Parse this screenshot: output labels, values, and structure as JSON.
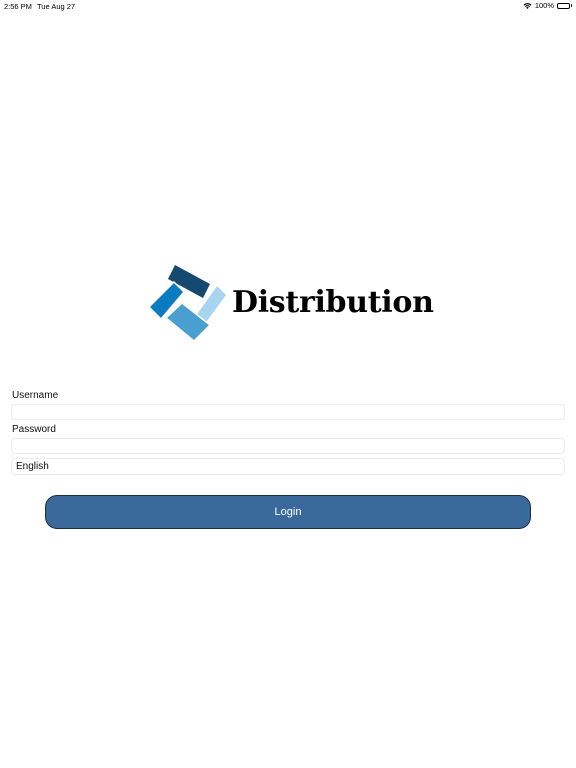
{
  "status_bar": {
    "time": "2:56 PM",
    "date": "Tue Aug 27",
    "battery": "100%",
    "wifi_icon": "wifi-icon",
    "battery_icon": "battery-icon"
  },
  "logo": {
    "text": "Distribution",
    "colors": [
      "#16496f",
      "#0b7bbf",
      "#a9d4f0",
      "#4a9fd0"
    ]
  },
  "form": {
    "username_label": "Username",
    "username_value": "",
    "password_label": "Password",
    "password_value": "",
    "language": "English"
  },
  "login_button": {
    "label": "Login",
    "color": "#3a6a9b"
  }
}
